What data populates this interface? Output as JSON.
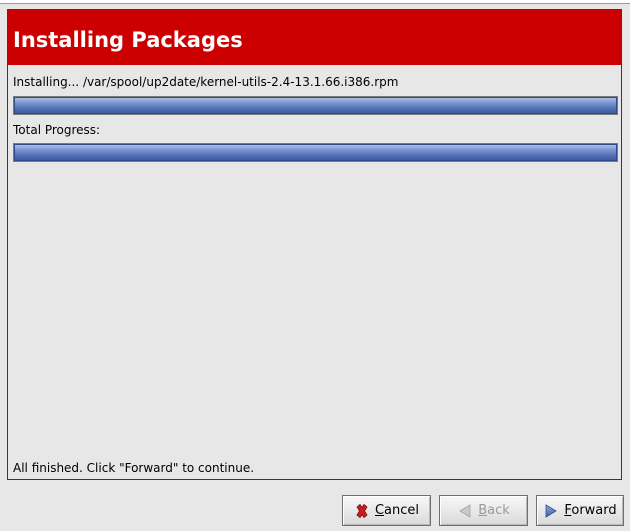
{
  "header": {
    "title": "Installing Packages"
  },
  "install": {
    "current_label": "Installing...  /var/spool/up2date/kernel-utils-2.4-13.1.66.i386.rpm",
    "current_progress": 1.0,
    "total_label": "Total Progress:",
    "total_progress": 1.0
  },
  "status": {
    "message": "All finished.  Click \"Forward\" to continue."
  },
  "buttons": {
    "cancel": {
      "mnemonic": "C",
      "rest": "ancel"
    },
    "back": {
      "mnemonic": "B",
      "rest": "ack"
    },
    "forward": {
      "mnemonic": "F",
      "rest": "orward"
    }
  },
  "colors": {
    "header_bg": "#cc0000",
    "progress_fill": "#4e6cb3",
    "panel_border": "#c00000"
  },
  "icons": {
    "cancel": "x-icon",
    "back": "arrow-left-icon",
    "forward": "arrow-right-icon"
  }
}
